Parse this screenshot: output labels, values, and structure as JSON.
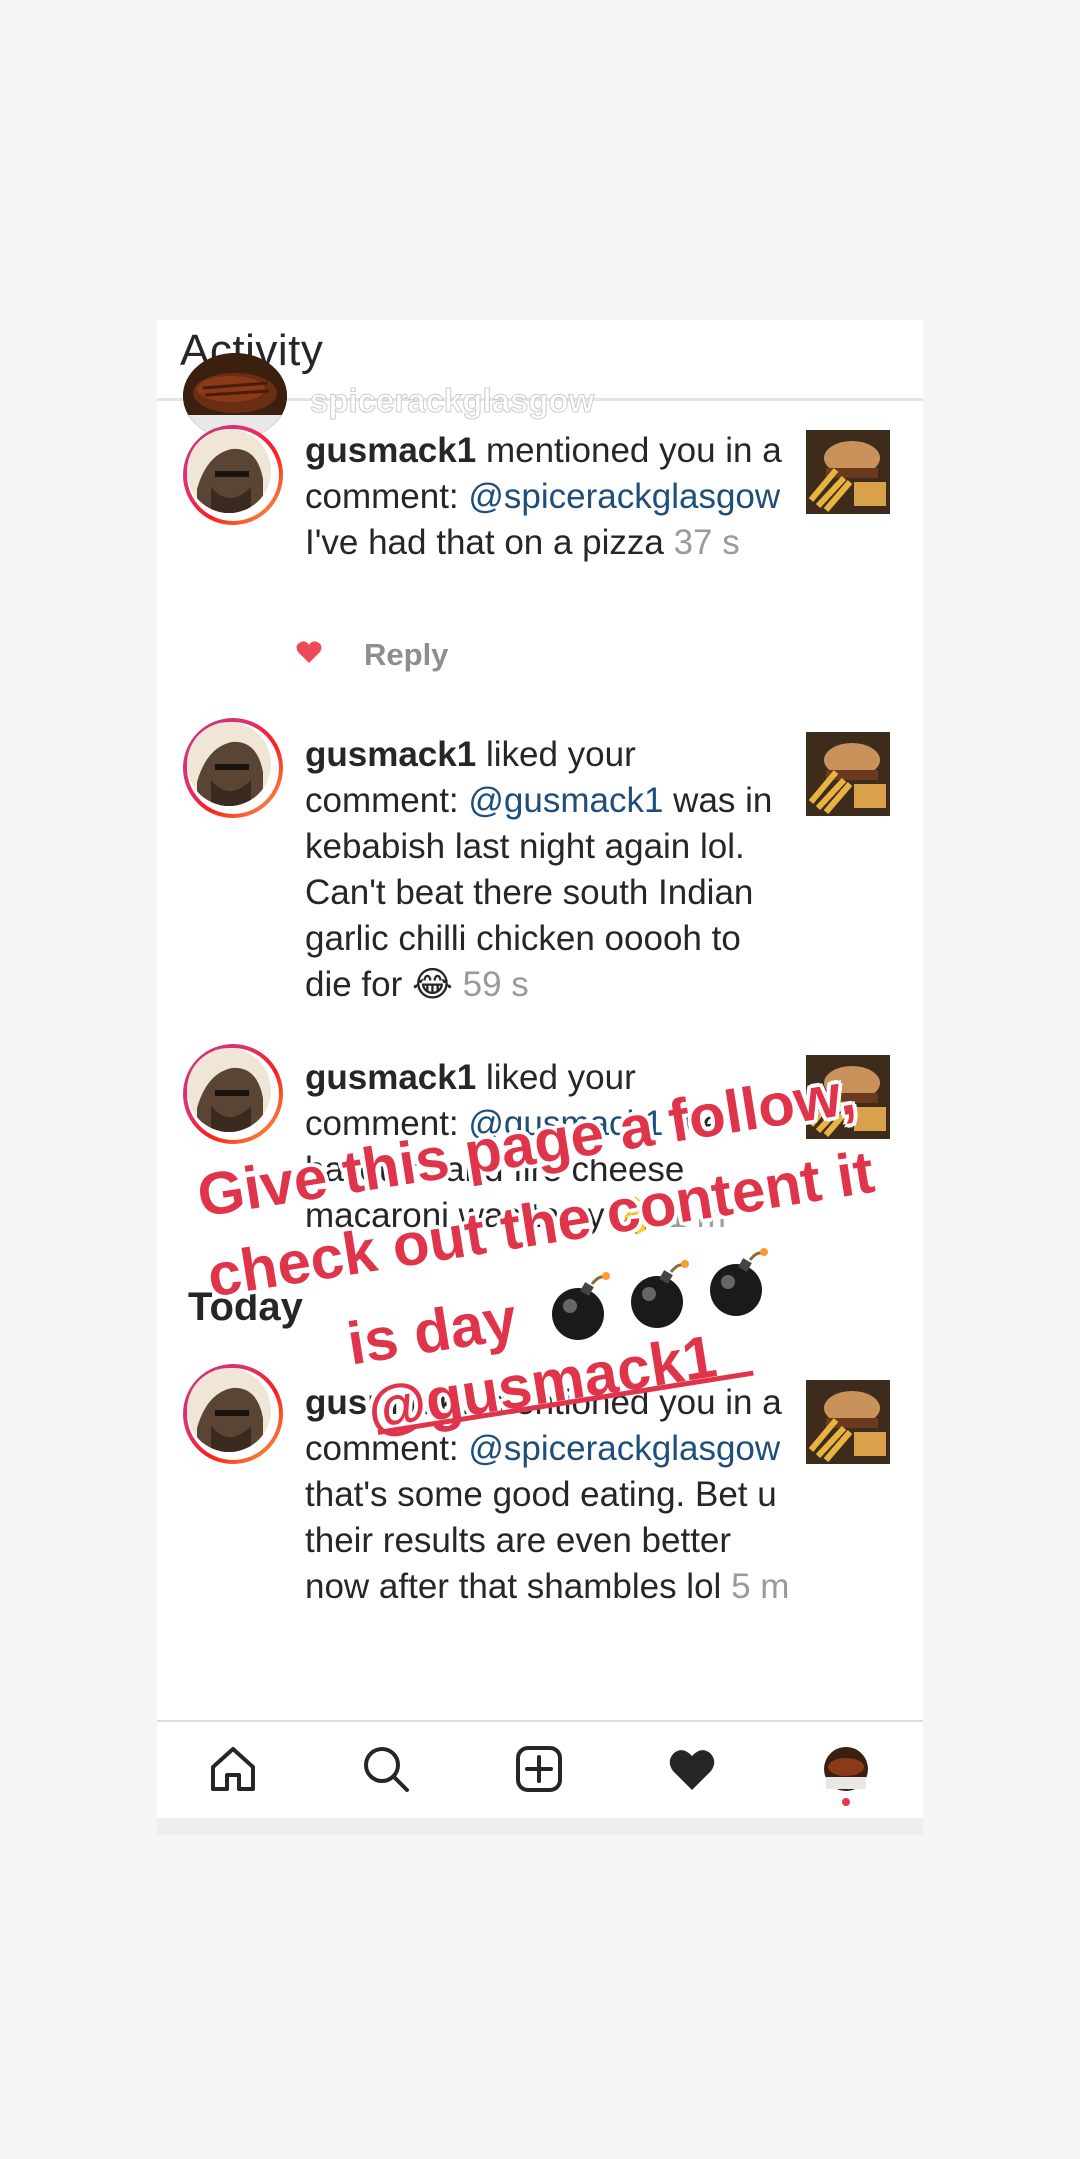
{
  "header": {
    "title": "Activity",
    "story_user": "spicerackglasgow"
  },
  "notifications": [
    {
      "user": "gusmack1",
      "action": " mentioned you in a comment: ",
      "mention": "@spicerackglasgow",
      "body": " I've had that on a pizza ",
      "time": "37 s",
      "reply_label": "Reply"
    },
    {
      "user": "gusmack1",
      "action": " liked your comment: ",
      "mention": "@gusmack1",
      "body": " was in kebabish last night again lol. Can't beat there south Indian garlic chilli chicken ooooh to die for 😂 ",
      "time": "59 s"
    },
    {
      "user": "gusmack1",
      "action": " liked your comment: ",
      "mention": "@gusmack1",
      "body": " the halloumi and fire cheese macaroni was tasty 👌 ",
      "time": "1 m"
    },
    {
      "user": "gusmack1",
      "action": " mentioned you in a comment: ",
      "mention": "@spicerackglasgow",
      "body": " that's some good eating. Bet u their results are even better now after that shambles lol ",
      "time": "5 m"
    }
  ],
  "section": {
    "today_label": "Today"
  },
  "tabs": [
    {
      "name": "home",
      "icon": "home-icon"
    },
    {
      "name": "search",
      "icon": "search-icon"
    },
    {
      "name": "new-post",
      "icon": "plus-square-icon"
    },
    {
      "name": "activity",
      "icon": "heart-icon"
    },
    {
      "name": "profile",
      "icon": "profile-avatar"
    }
  ],
  "overlay": {
    "line1": "Give this page a follow,",
    "line2": "check out the content it",
    "line3": "is day",
    "line4": "@gusmack1"
  },
  "colors": {
    "overlay_red": "#e0344b",
    "mention_blue": "#1f4e7a",
    "like_red": "#ed4956"
  }
}
